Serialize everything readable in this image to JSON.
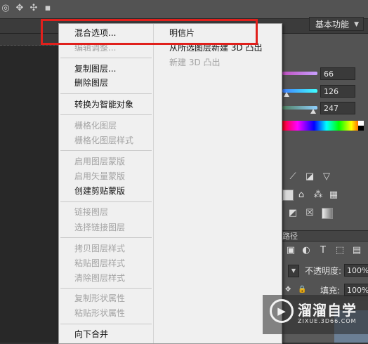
{
  "workspace": {
    "label": "基本功能"
  },
  "panel": {
    "slider_values": [
      "66",
      "126",
      "247"
    ],
    "layers_tab_label": "路径",
    "opacity_label": "不透明度:",
    "opacity_value": "100%",
    "fill_label": "填充:",
    "fill_value": "100%"
  },
  "menu": {
    "items": [
      {
        "label": "混合选项...",
        "enabled": true
      },
      {
        "label": "编辑调整...",
        "enabled": false
      },
      {
        "label": "复制图层...",
        "enabled": true
      },
      {
        "label": "删除图层",
        "enabled": true
      },
      {
        "label": "转换为智能对象",
        "enabled": true
      },
      {
        "label": "栅格化图层",
        "enabled": false
      },
      {
        "label": "栅格化图层样式",
        "enabled": false
      },
      {
        "label": "启用图层蒙版",
        "enabled": false
      },
      {
        "label": "启用矢量蒙版",
        "enabled": false
      },
      {
        "label": "创建剪贴蒙版",
        "enabled": true
      },
      {
        "label": "链接图层",
        "enabled": false
      },
      {
        "label": "选择链接图层",
        "enabled": false
      },
      {
        "label": "拷贝图层样式",
        "enabled": false
      },
      {
        "label": "粘贴图层样式",
        "enabled": false
      },
      {
        "label": "清除图层样式",
        "enabled": false
      },
      {
        "label": "复制形状属性",
        "enabled": false
      },
      {
        "label": "粘贴形状属性",
        "enabled": false
      },
      {
        "label": "向下合并",
        "enabled": true
      }
    ],
    "submenu": [
      {
        "label": "明信片",
        "enabled": true
      },
      {
        "label": "从所选图层新建 3D 凸出",
        "enabled": true
      },
      {
        "label": "新建 3D 凸出",
        "enabled": false
      }
    ]
  },
  "watermark": {
    "title": "溜溜自学",
    "url": "ZIXUE.3D66.COM"
  },
  "colors": {
    "highlight": "#e0201c",
    "menu_bg": "#f0f0f0",
    "disabled_text": "#a3a3a3",
    "panel_bg": "#535353"
  }
}
